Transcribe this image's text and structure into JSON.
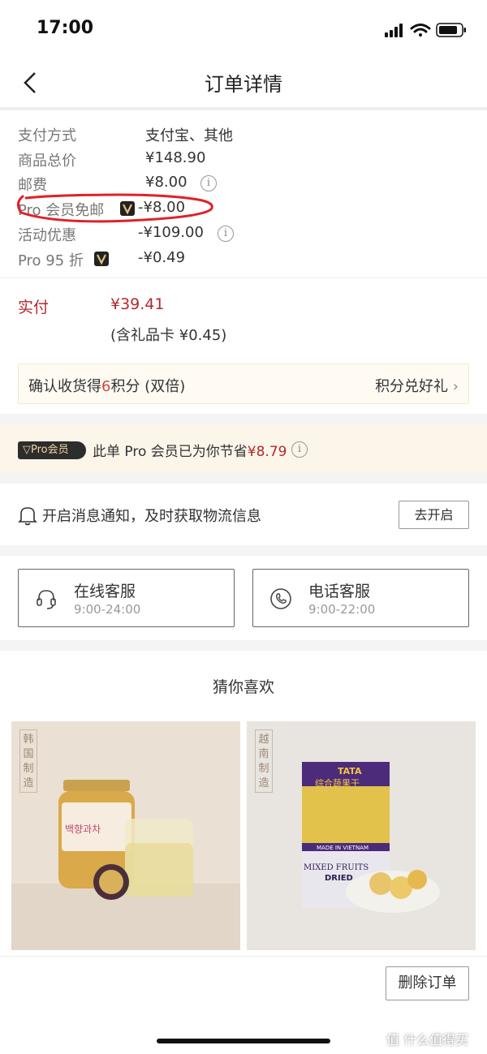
{
  "status_bar": {
    "time": "17:00"
  },
  "nav": {
    "title": "订单详情"
  },
  "order_rows": [
    {
      "label": "支付方式",
      "value": "支付宝、其他"
    },
    {
      "label": "商品总价",
      "value": "¥148.90"
    },
    {
      "label": "邮费",
      "value": "¥8.00"
    },
    {
      "label": "Pro 会员免邮",
      "value": "-¥8.00"
    },
    {
      "label": "活动优惠",
      "value": "-¥109.00"
    },
    {
      "label": "Pro 95 折",
      "value": "-¥0.49"
    }
  ],
  "payment": {
    "label": "实付",
    "amount": "¥39.41",
    "note": "(含礼品卡 ¥0.45)"
  },
  "points": {
    "prefix": "确认收货得",
    "count": "6",
    "suffix": "积分 (双倍)",
    "link": "积分兑好礼"
  },
  "pro_banner": {
    "tag": "Pro会员",
    "text": "此单 Pro 会员已为你节省",
    "saved": "¥8.79"
  },
  "notify": {
    "text": "开启消息通知，及时获取物流信息",
    "button": "去开启"
  },
  "service": [
    {
      "title": "在线客服",
      "hours": "9:00-24:00"
    },
    {
      "title": "电话客服",
      "hours": "9:00-22:00"
    }
  ],
  "recommend": {
    "title": "猜你喜欢",
    "products": [
      {
        "origin": "韩国制造",
        "jar_label": "백향과차"
      },
      {
        "origin": "越南制造",
        "bag_brand": "TATA",
        "bag_name": "综合蔬果干",
        "bag_made": "MADE IN VIETNAM",
        "bag_en": "MIXED FRUITS",
        "bag_en2": "DRIED"
      }
    ]
  },
  "footer": {
    "delete_button": "删除订单"
  },
  "watermark": "值 什么值得买",
  "colors": {
    "price_red": "#b4282d",
    "accent_red": "#d0463b",
    "pro_gold": "#f1d7a4",
    "pro_bg": "#fbf5ea",
    "handwritten_circle": "#e0202a"
  }
}
